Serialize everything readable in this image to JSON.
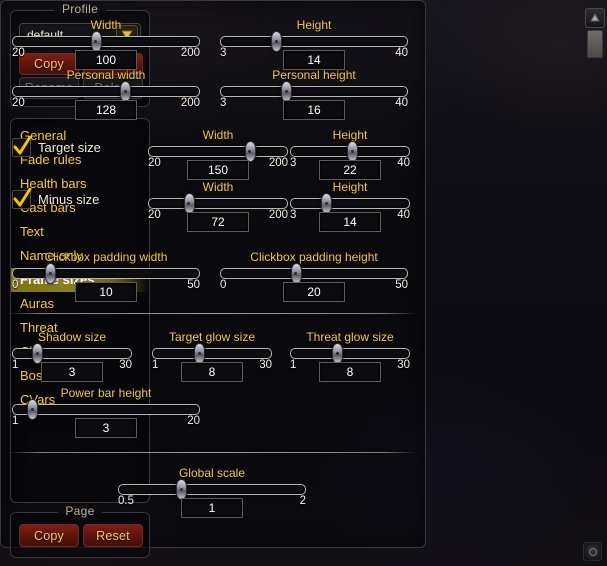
{
  "profile": {
    "title": "Profile",
    "dropdown_value": "default",
    "dropdown_icon": "chevron-down-icon",
    "copy_label": "Copy",
    "reset_label": "Reset",
    "rename_label": "Rename",
    "delete_label": "Delete"
  },
  "sidebar": {
    "items": [
      {
        "label": "General",
        "selected": false
      },
      {
        "label": "Fade rules",
        "selected": false
      },
      {
        "label": "Health bars",
        "selected": false
      },
      {
        "label": "Cast bars",
        "selected": false
      },
      {
        "label": "Text",
        "selected": false
      },
      {
        "label": "Name-only",
        "selected": false
      },
      {
        "label": "Frame sizes",
        "selected": true
      },
      {
        "label": "Auras",
        "selected": false
      },
      {
        "label": "Threat",
        "selected": false
      },
      {
        "label": "Class powers",
        "selected": false
      },
      {
        "label": "Boss mods",
        "selected": false
      },
      {
        "label": "CVars",
        "selected": false
      }
    ]
  },
  "page": {
    "title": "Page",
    "copy_label": "Copy",
    "reset_label": "Reset"
  },
  "checkboxes": {
    "target_size": {
      "label": "Target size",
      "checked": true
    },
    "minus_size": {
      "label": "Minus size",
      "checked": true
    }
  },
  "sliders": {
    "width": {
      "label": "Width",
      "min": "20",
      "max": "200",
      "value": "100"
    },
    "height": {
      "label": "Height",
      "min": "3",
      "max": "40",
      "value": "14"
    },
    "personal_width": {
      "label": "Personal width",
      "min": "20",
      "max": "200",
      "value": "128"
    },
    "personal_height": {
      "label": "Personal height",
      "min": "3",
      "max": "40",
      "value": "16"
    },
    "target_width": {
      "label": "Width",
      "min": "20",
      "max": "200",
      "value": "150"
    },
    "target_height": {
      "label": "Height",
      "min": "3",
      "max": "40",
      "value": "22"
    },
    "minus_width": {
      "label": "Width",
      "min": "20",
      "max": "200",
      "value": "72"
    },
    "minus_height": {
      "label": "Height",
      "min": "3",
      "max": "40",
      "value": "14"
    },
    "clickbox_pad_width": {
      "label": "Clickbox padding width",
      "min": "0",
      "max": "50",
      "value": "10"
    },
    "clickbox_pad_height": {
      "label": "Clickbox padding height",
      "min": "0",
      "max": "50",
      "value": "20"
    },
    "shadow_size": {
      "label": "Shadow size",
      "min": "1",
      "max": "30",
      "value": "3"
    },
    "target_glow_size": {
      "label": "Target glow size",
      "min": "1",
      "max": "30",
      "value": "8"
    },
    "threat_glow_size": {
      "label": "Threat glow size",
      "min": "1",
      "max": "30",
      "value": "8"
    },
    "power_bar_height": {
      "label": "Power bar height",
      "min": "1",
      "max": "20",
      "value": "3"
    },
    "global_scale": {
      "label": "Global scale",
      "min": "0.5",
      "max": "2",
      "value": "1"
    }
  },
  "scrollbar": {
    "up_icon": "scroll-up-arrow-icon"
  },
  "resize": {
    "grip_icon": "resize-grip-icon"
  },
  "colors": {
    "accent_gold": "#f2c84b",
    "selected_row": "#8a8020",
    "button_red": "#7e1f14",
    "panel_border": "#3a3540"
  }
}
